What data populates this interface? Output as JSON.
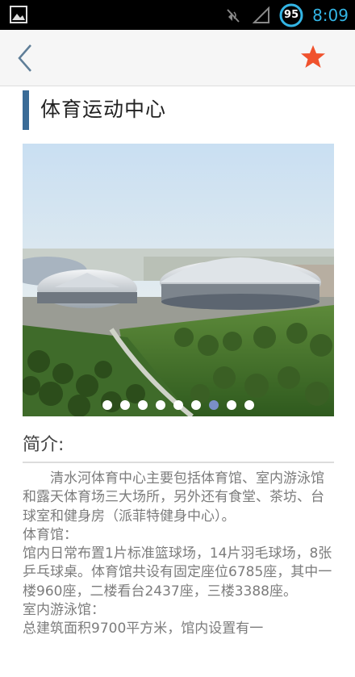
{
  "status_bar": {
    "battery_level": "95",
    "time": "8:09",
    "icons": [
      "gallery-icon",
      "mute-icon",
      "signal-icon",
      "battery-icon"
    ]
  },
  "action_bar": {
    "back_icon": "chevron-left-icon",
    "favorite_icon": "star-icon",
    "favorite_color": "#f0522d"
  },
  "page": {
    "title": "体育运动中心",
    "title_bar_color": "#3a6b96",
    "gallery": {
      "slide_count": 9,
      "active_index": 6
    },
    "intro_heading": "简介:",
    "paragraphs": [
      "清水河体育中心主要包括体育馆、室内游泳馆和露天体育场三大场所，另外还有食堂、茶坊、台球室和健身房（派菲特健身中心）。",
      "体育馆：",
      "馆内日常布置1片标准篮球场，14片羽毛球场，8张乒乓球桌。体育馆共设有固定座位6785座，其中一楼960座，二楼看台2437座，三楼3388座。",
      "室内游泳馆：",
      "总建筑面积9700平方米，馆内设置有一"
    ]
  }
}
